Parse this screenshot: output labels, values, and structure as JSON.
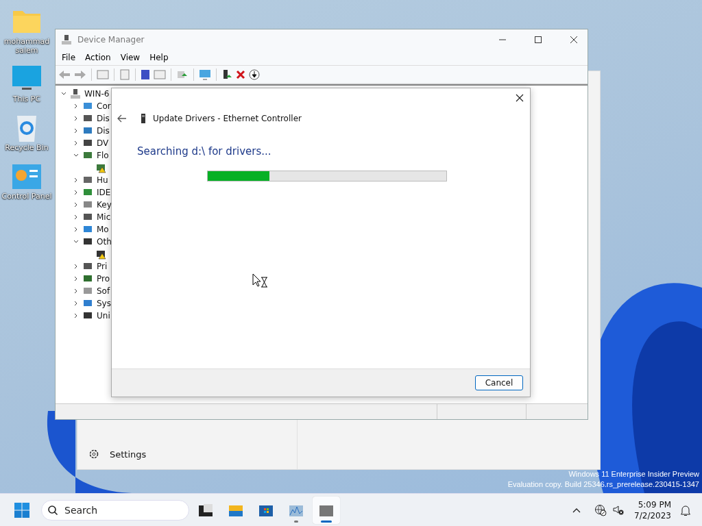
{
  "desktop_icons": [
    {
      "kind": "folder",
      "label": "mohammad salem"
    },
    {
      "kind": "pc",
      "label": "This PC"
    },
    {
      "kind": "bin",
      "label": "Recycle Bin"
    },
    {
      "kind": "panel",
      "label": "Control Panel"
    }
  ],
  "settings_window": {
    "nav_item": "Settings"
  },
  "device_manager": {
    "title": "Device Manager",
    "menu": [
      "File",
      "Action",
      "View",
      "Help"
    ],
    "tree": {
      "label": "WIN-6",
      "expanded": true,
      "children": [
        {
          "kind": "computer",
          "label": "Cor",
          "expanded": false
        },
        {
          "kind": "disk",
          "label": "Dis",
          "expanded": false
        },
        {
          "kind": "display",
          "label": "Dis",
          "expanded": false
        },
        {
          "kind": "dvd",
          "label": "DV",
          "expanded": false
        },
        {
          "kind": "floppy",
          "label": "Flo",
          "expanded": true,
          "children": [
            {
              "kind": "floppy",
              "warning": true
            }
          ]
        },
        {
          "kind": "hid",
          "label": "Hu",
          "expanded": false
        },
        {
          "kind": "ide",
          "label": "IDE",
          "expanded": false
        },
        {
          "kind": "keyboard",
          "label": "Key",
          "expanded": false
        },
        {
          "kind": "mouse",
          "label": "Mic",
          "expanded": false
        },
        {
          "kind": "monitor",
          "label": "Mo",
          "expanded": false
        },
        {
          "kind": "other",
          "label": "Oth",
          "expanded": true,
          "children": [
            {
              "kind": "other",
              "warning": true
            }
          ]
        },
        {
          "kind": "printer",
          "label": "Pri",
          "expanded": false
        },
        {
          "kind": "processor",
          "label": "Pro",
          "expanded": false
        },
        {
          "kind": "software",
          "label": "Sof",
          "expanded": false
        },
        {
          "kind": "system",
          "label": "Sys",
          "expanded": false
        },
        {
          "kind": "usb",
          "label": "Uni",
          "expanded": false
        }
      ]
    }
  },
  "dialog": {
    "title": "Update Drivers - Ethernet Controller",
    "status": "Searching d:\\ for drivers...",
    "progress": {
      "level": 0.26
    },
    "buttons": [
      "Cancel"
    ]
  },
  "watermark": [
    "Windows 11 Enterprise Insider Preview",
    "Evaluation copy. Build 25346.rs_prerelease.230415-1347"
  ],
  "taskbar": {
    "search": {
      "placeholder": "Search"
    },
    "apps": [
      {
        "kind": "task-view",
        "running": false,
        "selected": false
      },
      {
        "kind": "explorer",
        "running": false,
        "selected": false
      },
      {
        "kind": "store",
        "running": false,
        "selected": false
      },
      {
        "kind": "monitor",
        "running": true,
        "selected": false
      },
      {
        "kind": "device-manager",
        "running": true,
        "selected": true
      }
    ],
    "time": "5:09 PM",
    "date": "7/2/2023"
  }
}
